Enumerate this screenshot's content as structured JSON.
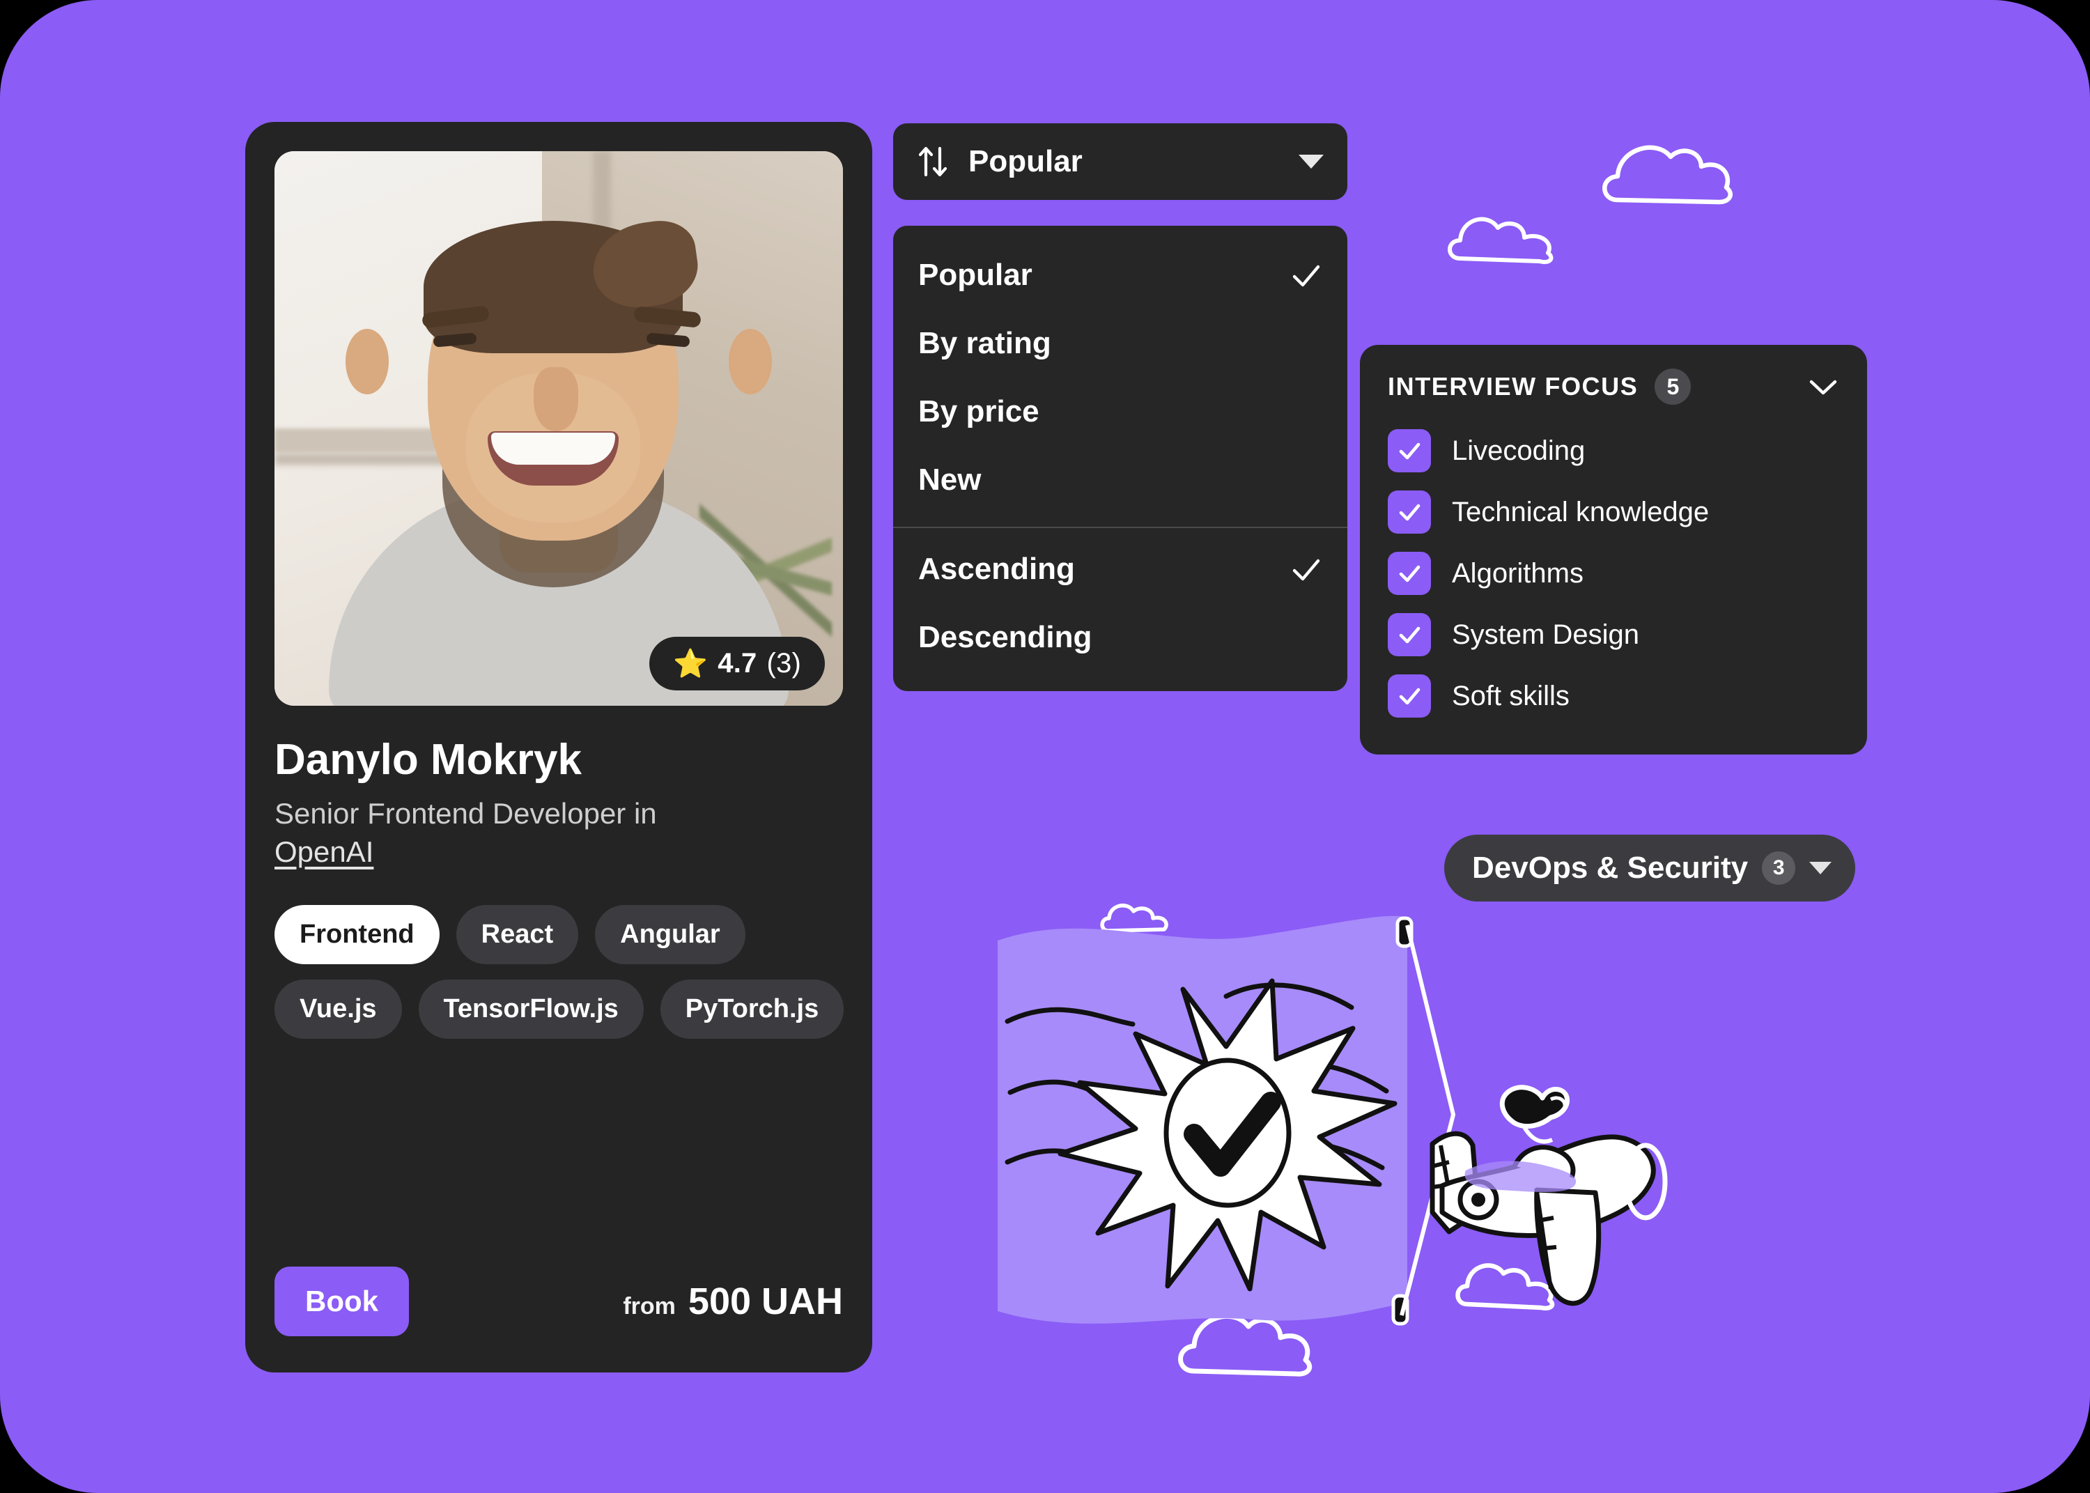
{
  "theme": {
    "background_purple": "#8B5CF6",
    "card_dark": "#242424",
    "panel_dark": "#262626",
    "chip_dark": "#3C3C40",
    "accent_purple": "#8B5CF6",
    "flag_light_purple": "#A78BFA",
    "star_gold": "#F5B93B"
  },
  "profile_card": {
    "rating": {
      "star_icon": "star-icon",
      "value": "4.7",
      "reviews": "(3)"
    },
    "name": "Danylo Mokryk",
    "role": "Senior Frontend Developer in",
    "company": "OpenAI",
    "tags": [
      {
        "label": "Frontend",
        "active": true
      },
      {
        "label": "React",
        "active": false
      },
      {
        "label": "Angular",
        "active": false
      },
      {
        "label": "Vue.js",
        "active": false
      },
      {
        "label": "TensorFlow.js",
        "active": false
      },
      {
        "label": "PyTorch.js",
        "active": false
      }
    ],
    "book_label": "Book",
    "price_prefix": "from",
    "price_value": "500 UAH"
  },
  "sort": {
    "icon": "sort-arrows-icon",
    "selected": "Popular",
    "caret_icon": "chevron-down-icon",
    "menu": {
      "order_by": [
        {
          "label": "Popular",
          "checked": true
        },
        {
          "label": "By rating",
          "checked": false
        },
        {
          "label": "By price",
          "checked": false
        },
        {
          "label": "New",
          "checked": false
        }
      ],
      "direction": [
        {
          "label": "Ascending",
          "checked": true
        },
        {
          "label": "Descending",
          "checked": false
        }
      ]
    }
  },
  "interview_focus": {
    "title": "INTERVIEW FOCUS",
    "count": "5",
    "chevron_icon": "chevron-down-icon",
    "items": [
      {
        "label": "Livecoding",
        "checked": true
      },
      {
        "label": "Technical knowledge",
        "checked": true
      },
      {
        "label": "Algorithms",
        "checked": true
      },
      {
        "label": "System Design",
        "checked": true
      },
      {
        "label": "Soft skills",
        "checked": true
      }
    ]
  },
  "devops_pill": {
    "label": "DevOps & Security",
    "count": "3",
    "caret_icon": "chevron-down-icon"
  },
  "illustration": {
    "flag_icon": "flag-with-checkmark-burst",
    "plane_icon": "airplane-with-pilot-icon",
    "clouds": [
      "cloud-icon",
      "cloud-icon",
      "cloud-icon",
      "cloud-icon",
      "cloud-icon"
    ]
  }
}
